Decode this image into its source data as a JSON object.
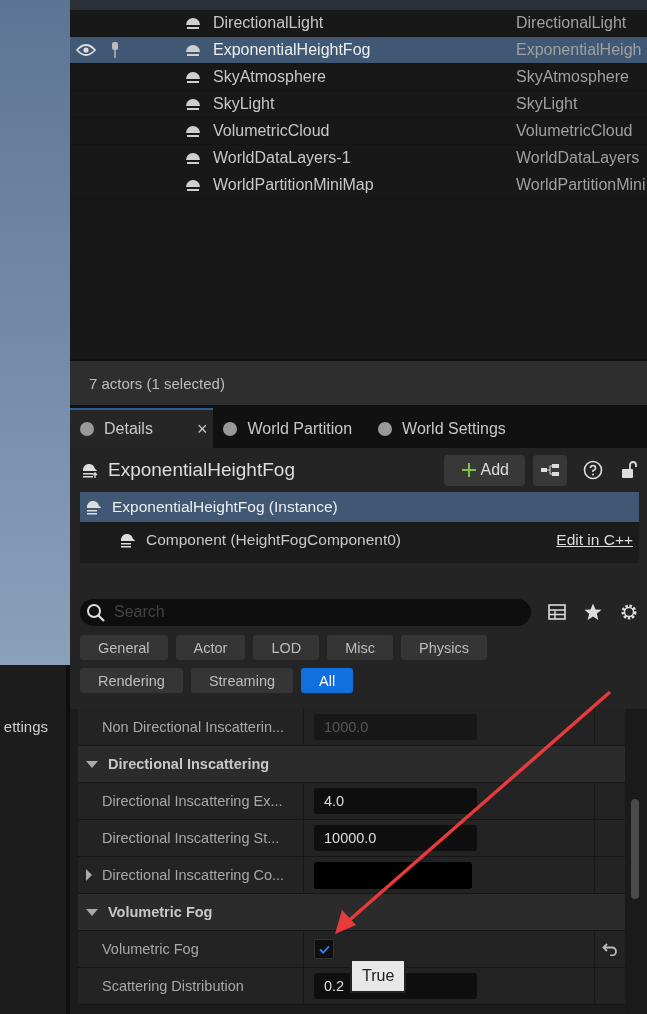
{
  "side_panel": {
    "label": "ettings"
  },
  "outliner": {
    "rows": [
      {
        "label": "DirectionalLight",
        "type": "DirectionalLight",
        "selected": false
      },
      {
        "label": "ExponentialHeightFog",
        "type": "ExponentialHeigh",
        "selected": true
      },
      {
        "label": "SkyAtmosphere",
        "type": "SkyAtmosphere",
        "selected": false
      },
      {
        "label": "SkyLight",
        "type": "SkyLight",
        "selected": false
      },
      {
        "label": "VolumetricCloud",
        "type": "VolumetricCloud",
        "selected": false
      },
      {
        "label": "WorldDataLayers-1",
        "type": "WorldDataLayers",
        "selected": false
      },
      {
        "label": "WorldPartitionMiniMap",
        "type": "WorldPartitionMini",
        "selected": false
      }
    ],
    "status": "7 actors (1 selected)"
  },
  "details": {
    "tabs": [
      {
        "label": "Details",
        "selected": true,
        "close": "×"
      },
      {
        "label": "World Partition",
        "selected": false
      },
      {
        "label": "World Settings",
        "selected": false
      }
    ],
    "title": "ExponentialHeightFog",
    "add_button": "Add",
    "components": [
      {
        "label": "ExponentialHeightFog (Instance)",
        "selected": true
      },
      {
        "label": "Component (HeightFogComponent0)",
        "selected": false,
        "link": "Edit in C++"
      }
    ],
    "search": {
      "placeholder": "Search"
    },
    "filters": [
      [
        {
          "label": "General",
          "selected": false
        },
        {
          "label": "Actor",
          "selected": false
        },
        {
          "label": "LOD",
          "selected": false
        },
        {
          "label": "Misc",
          "selected": false
        },
        {
          "label": "Physics",
          "selected": false
        }
      ],
      [
        {
          "label": "Rendering",
          "selected": false
        },
        {
          "label": "Streaming",
          "selected": false
        },
        {
          "label": "All",
          "selected": true
        }
      ]
    ],
    "properties": [
      {
        "kind": "text",
        "label": "Non Directional Inscatterin...",
        "value": "1000.0",
        "disabled": true
      },
      {
        "kind": "section",
        "label": "Directional Inscattering",
        "expanded": true
      },
      {
        "kind": "text",
        "label": "Directional Inscattering Ex...",
        "value": "4.0",
        "disabled": false
      },
      {
        "kind": "text",
        "label": "Directional Inscattering St...",
        "value": "10000.0",
        "disabled": false
      },
      {
        "kind": "color",
        "label": "Directional Inscattering Co...",
        "expanded": false
      },
      {
        "kind": "section",
        "label": "Volumetric Fog",
        "expanded": true
      },
      {
        "kind": "checkbox",
        "label": "Volumetric Fog",
        "checked": true,
        "tooltip": "True"
      },
      {
        "kind": "text",
        "label": "Scattering Distribution",
        "value": "0.2",
        "disabled": false
      }
    ]
  }
}
